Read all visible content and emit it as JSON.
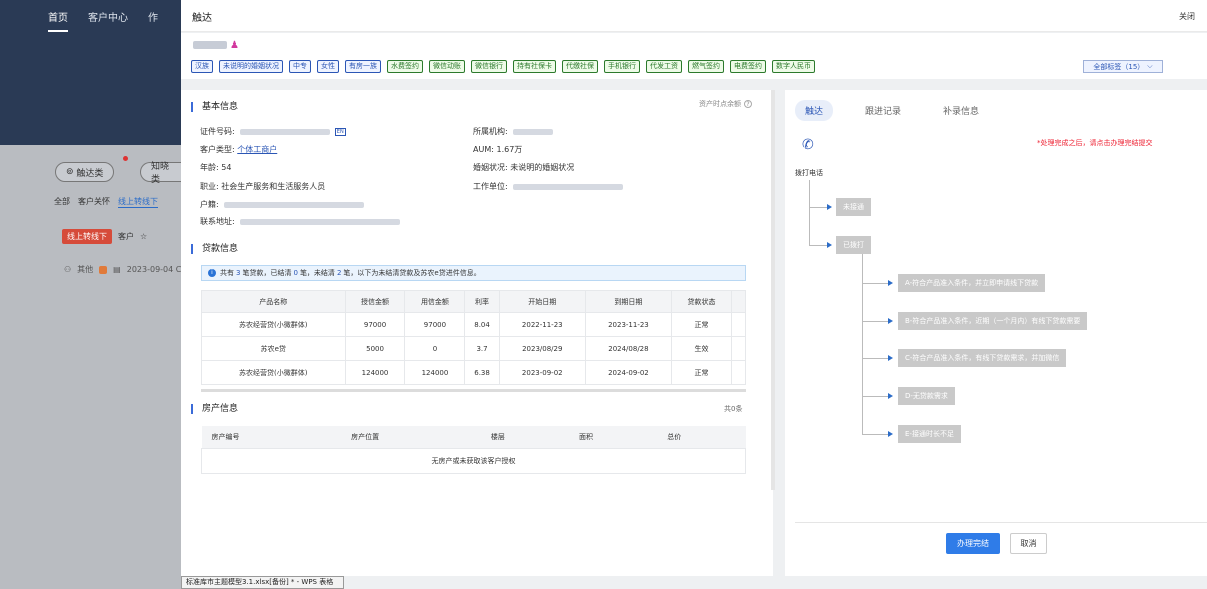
{
  "background": {
    "nav": [
      "首页",
      "客户中心",
      "作"
    ],
    "pills": [
      "触达类",
      "知晓类"
    ],
    "tabs": [
      "全部",
      "客户关怀",
      "线上转线下"
    ],
    "tag": "线上转线下",
    "customer_prefix": "客户",
    "meta_other": "其他",
    "meta_date": "2023-09-04 C"
  },
  "modal": {
    "title": "触达",
    "close_label": "关闭",
    "tags_blue": [
      "汉族",
      "未说明的婚姻状况",
      "中专",
      "女性",
      "有房一族"
    ],
    "tags_green": [
      "水费签约",
      "微信动账",
      "微信银行",
      "持有社保卡",
      "代缴社保",
      "手机银行",
      "代发工资",
      "燃气签约",
      "电费签约",
      "数字人民币"
    ],
    "all_tags_label": "全部标签（15）",
    "basic_info": {
      "title": "基本信息",
      "as_of_label": "资产时点余额",
      "id_label": "证件号码:",
      "id_badge": "EN",
      "type_label": "客户类型:",
      "type_value": "个体工商户",
      "age_label": "年龄:",
      "age_value": "54",
      "job_label": "职业:",
      "job_value": "社会生产服务和生活服务人员",
      "hukou_label": "户籍:",
      "address_label": "联系地址:",
      "org_label": "所属机构:",
      "aum_label": "AUM:",
      "aum_value": "1.67万",
      "marital_label": "婚姻状况:",
      "marital_value": "未说明的婚姻状况",
      "work_label": "工作单位:"
    },
    "loan_info": {
      "title": "贷款信息",
      "notice_prefix": "共有",
      "total": "3",
      "notice_mid1": "笔贷款，已结清",
      "settled": "0",
      "notice_mid2": "笔，未结清",
      "unsettled": "2",
      "notice_suffix": "笔，以下为未结清贷款及苏农e贷进件信息。",
      "columns": [
        "产品名称",
        "授信金额",
        "用信金额",
        "利率",
        "开始日期",
        "到期日期",
        "贷款状态"
      ],
      "rows": [
        [
          "苏农经营贷(小微群体)",
          "97000",
          "97000",
          "8.04",
          "2022-11-23",
          "2023-11-23",
          "正常"
        ],
        [
          "苏农e贷",
          "5000",
          "0",
          "3.7",
          "2023/08/29",
          "2024/08/28",
          "生效"
        ],
        [
          "苏农经营贷(小微群体)",
          "124000",
          "124000",
          "6.38",
          "2023-09-02",
          "2024-09-02",
          "正常"
        ]
      ]
    },
    "house_info": {
      "title": "房产信息",
      "count": "共0条",
      "columns": [
        "房产编号",
        "房产位置",
        "楼层",
        "面积",
        "总价"
      ],
      "empty": "无房产或未获取该客户授权"
    },
    "right": {
      "tabs": [
        "触达",
        "跟进记录",
        "补录信息"
      ],
      "warning": "*处理完成之后，请点击办理完结提交",
      "phone_label": "拨打电话",
      "nodes": [
        "未接通",
        "已拨打"
      ],
      "options": [
        "A-符合产品准入条件，并立即申请线下贷款",
        "B-符合产品准入条件，近期（一个月内）有线下贷款需要",
        "C-符合产品准入条件，有线下贷款需求，并加微信",
        "D-无贷款需求",
        "E-接通时长不足"
      ],
      "submit": "办理完结",
      "cancel": "取消"
    }
  },
  "taskbar": "标准库市主题模型3.1.xlsx[备份] * - WPS 表格"
}
